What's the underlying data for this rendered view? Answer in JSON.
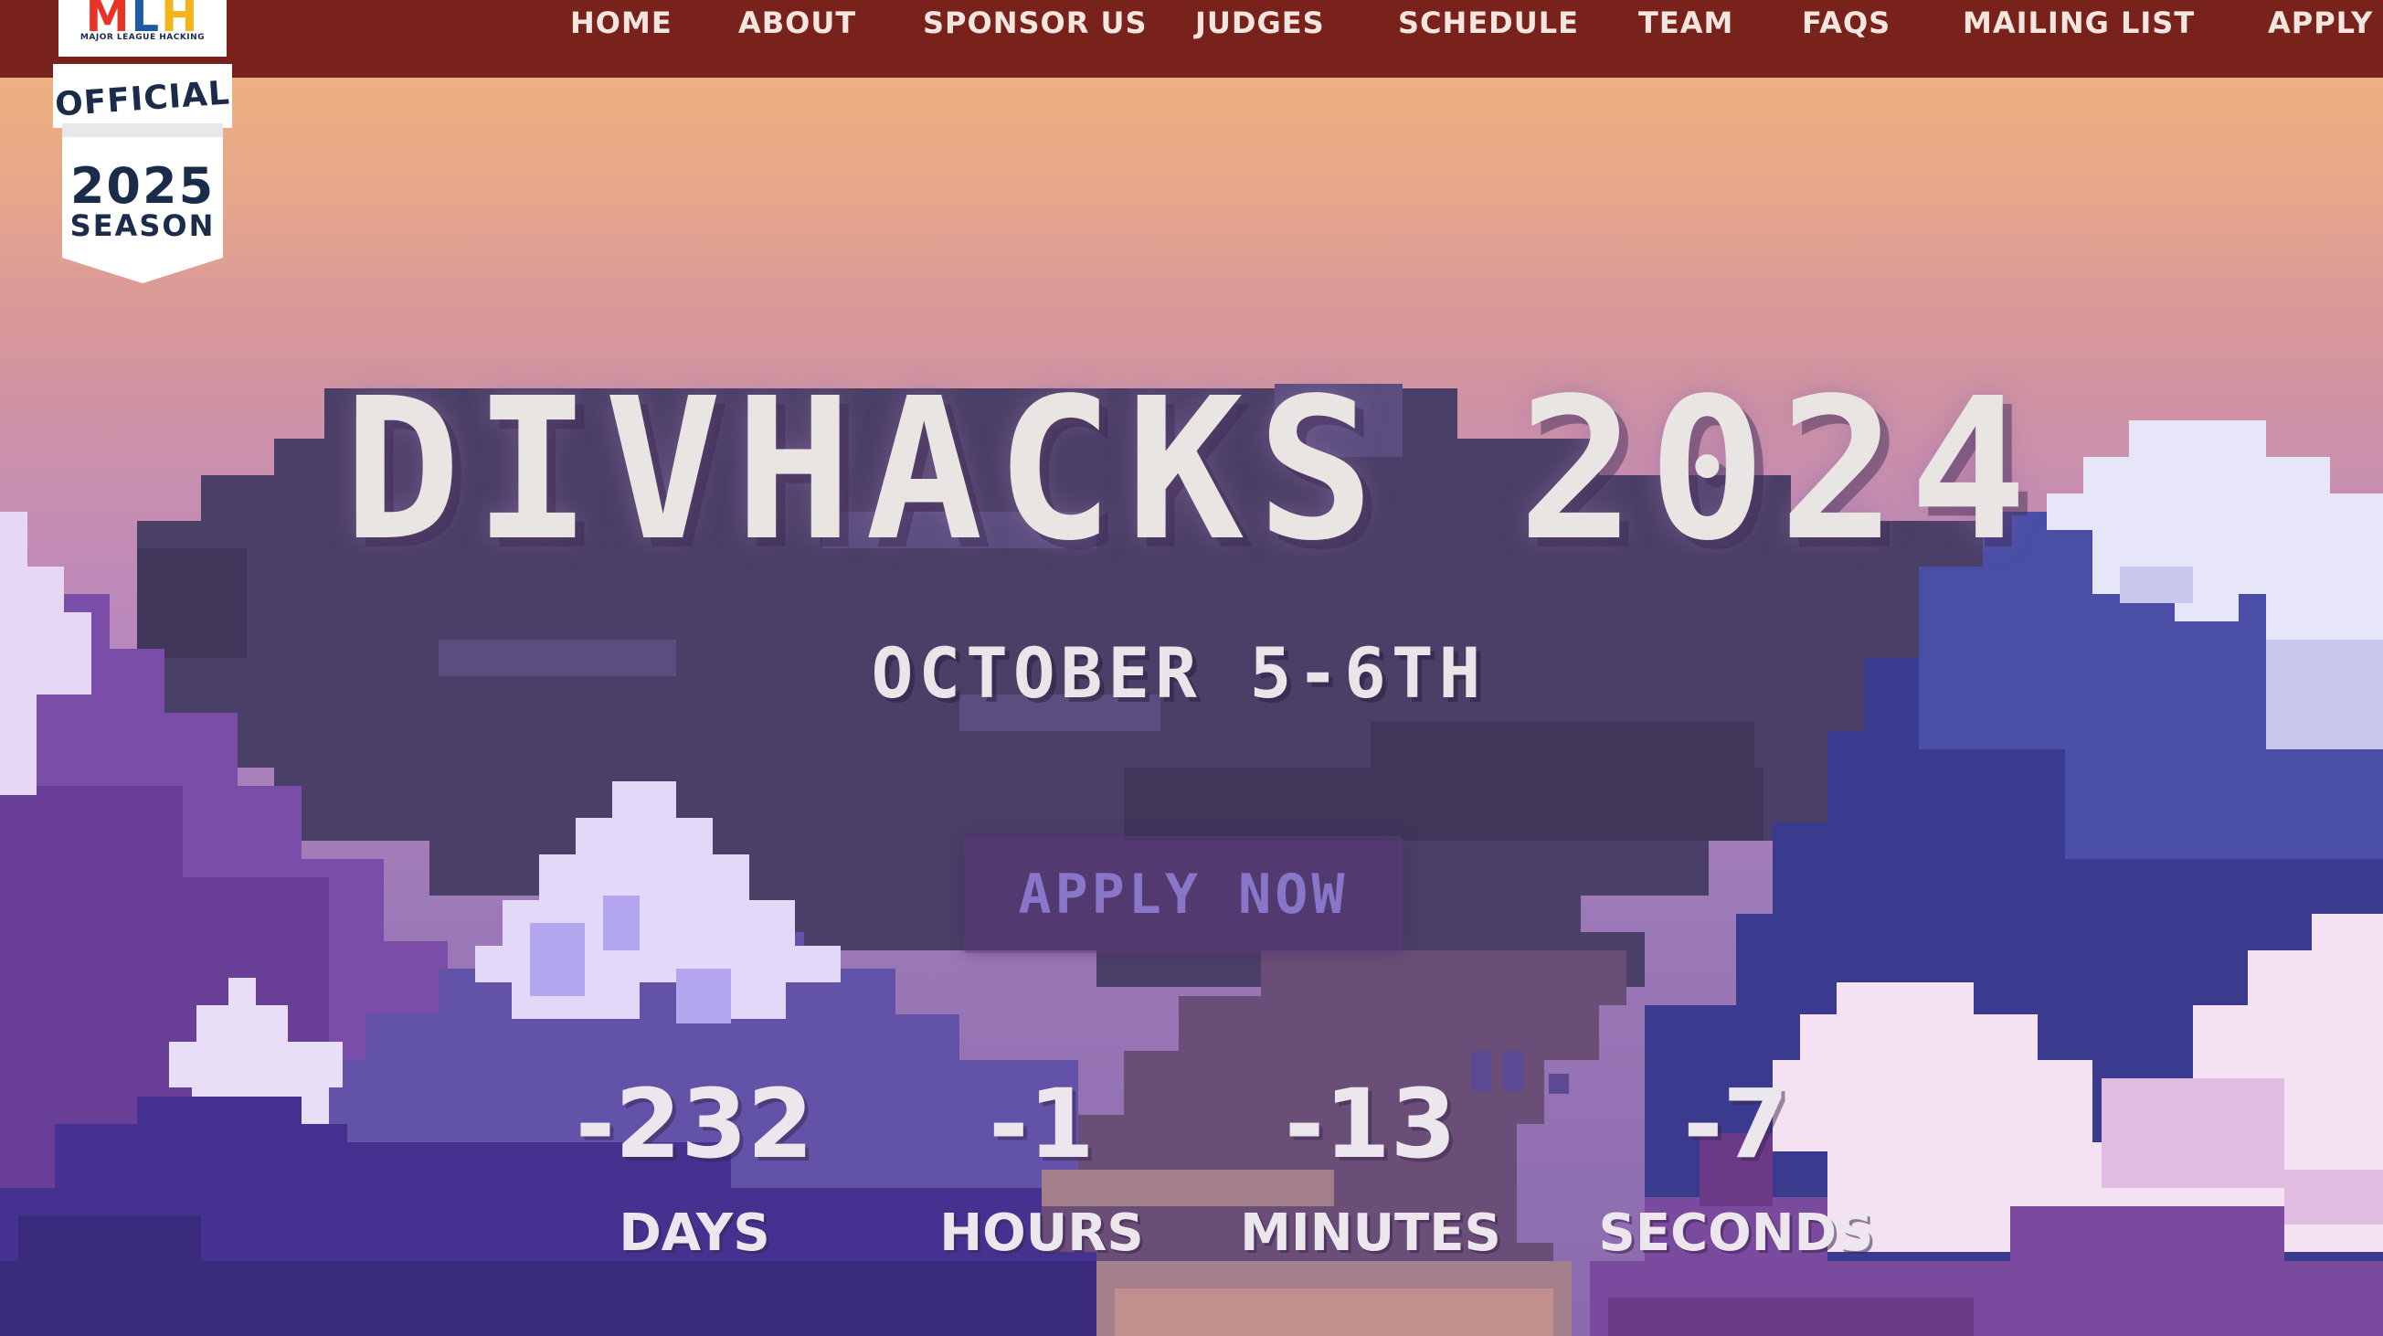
{
  "nav": {
    "items": [
      {
        "label": "HOME"
      },
      {
        "label": "ABOUT"
      },
      {
        "label": "SPONSOR US"
      },
      {
        "label": "JUDGES"
      },
      {
        "label": "SCHEDULE"
      },
      {
        "label": "TEAM"
      },
      {
        "label": "FAQS"
      },
      {
        "label": "MAILING LIST"
      },
      {
        "label": "APPLY"
      }
    ]
  },
  "badge": {
    "logo_letters": [
      "M",
      "L",
      "H"
    ],
    "subtitle": "MAJOR LEAGUE HACKING",
    "official": "OFFICIAL",
    "year": "2025",
    "season": "SEASON"
  },
  "hero": {
    "title": "DIVHACKS 2024",
    "date": "OCTOBER 5-6TH",
    "apply_button": "APPLY NOW"
  },
  "countdown": [
    {
      "value": "-232",
      "label": "DAYS"
    },
    {
      "value": "-1",
      "label": "HOURS"
    },
    {
      "value": "-13",
      "label": "MINUTES"
    },
    {
      "value": "-7",
      "label": "SECONDS"
    }
  ],
  "colors": {
    "nav_bg": "#78221b",
    "title_text": "#e8e5e3",
    "button_text": "#8877c9",
    "badge_navy": "#1b2b4a",
    "mlh_red": "#e73427",
    "mlh_blue": "#1f5aa6",
    "mlh_yellow": "#f2b416"
  }
}
